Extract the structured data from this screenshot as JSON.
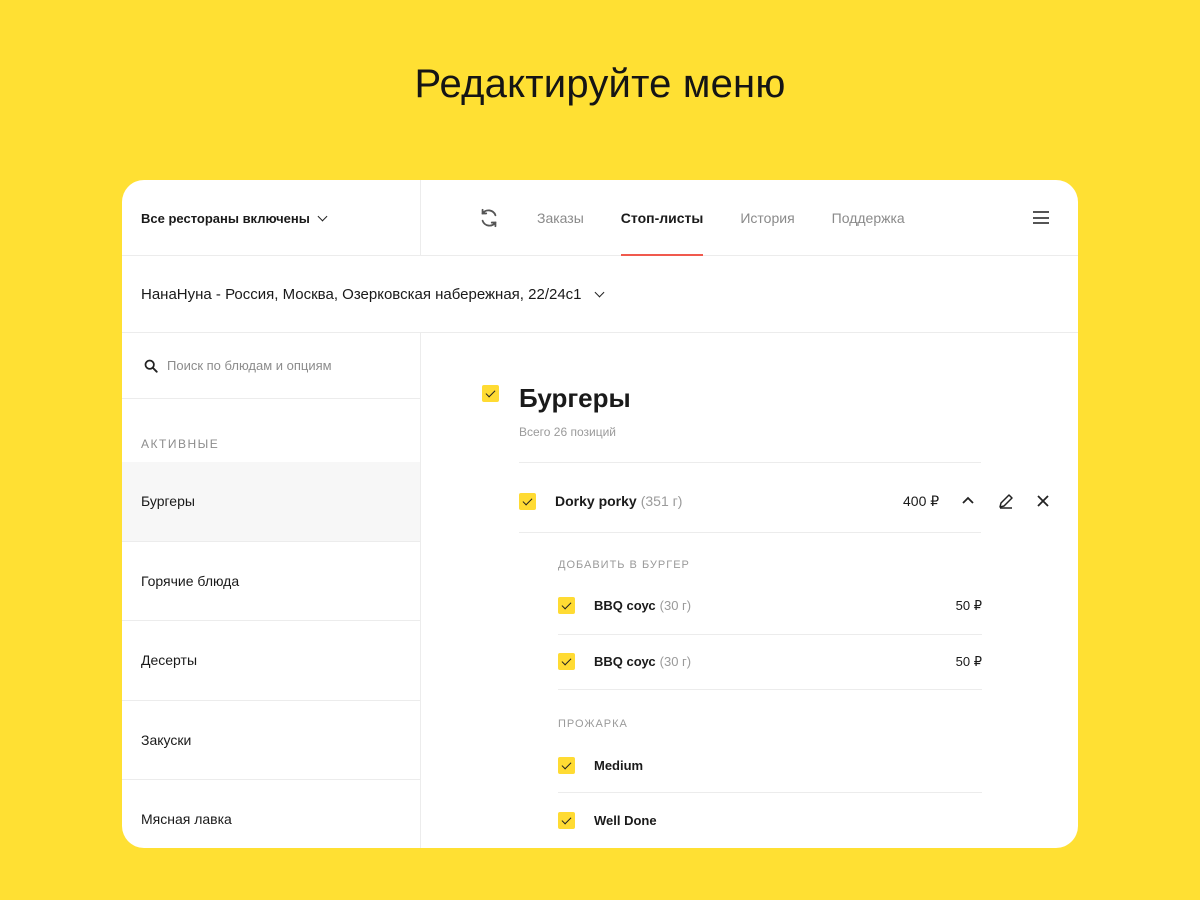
{
  "headline": "Редактируйте меню",
  "topbar": {
    "restaurants_switch": "Все рестораны включены",
    "tabs": [
      {
        "label": "Заказы",
        "active": false
      },
      {
        "label": "Стоп-листы",
        "active": true
      },
      {
        "label": "История",
        "active": false
      },
      {
        "label": "Поддержка",
        "active": false
      }
    ]
  },
  "address": "НанаНуна - Россия, Москва, Озерковская набережная, 22/24с1",
  "sidebar": {
    "search_placeholder": "Поиск по блюдам и опциям",
    "section_label": "АКТИВНЫЕ",
    "categories": [
      "Бургеры",
      "Горячие блюда",
      "Десерты",
      "Закуски",
      "Мясная лавка"
    ],
    "active_category": "Бургеры"
  },
  "main": {
    "group_title": "Бургеры",
    "group_subtitle": "Всего 26 позиций",
    "dish": {
      "name": "Dorky porky",
      "weight": "(351 г)",
      "price": "400 ₽"
    },
    "options": [
      {
        "label": "ДОБАВИТЬ В БУРГЕР",
        "items": [
          {
            "name": "BBQ соус",
            "weight": "(30 г)",
            "price": "50 ₽"
          },
          {
            "name": "BBQ соус",
            "weight": "(30 г)",
            "price": "50 ₽"
          }
        ]
      },
      {
        "label": "ПРОЖАРКА",
        "items": [
          {
            "name": "Medium",
            "weight": "",
            "price": ""
          },
          {
            "name": "Well Done",
            "weight": "",
            "price": ""
          }
        ]
      }
    ]
  },
  "colors": {
    "background": "#FFE033",
    "checkbox": "#FFDB33",
    "active_tab_underline": "#F0594D"
  },
  "icons": [
    "refresh-icon",
    "menu-icon",
    "chevron-down-icon",
    "search-icon",
    "chevron-up-icon",
    "pencil-icon",
    "close-icon",
    "checkbox-checked-icon"
  ]
}
